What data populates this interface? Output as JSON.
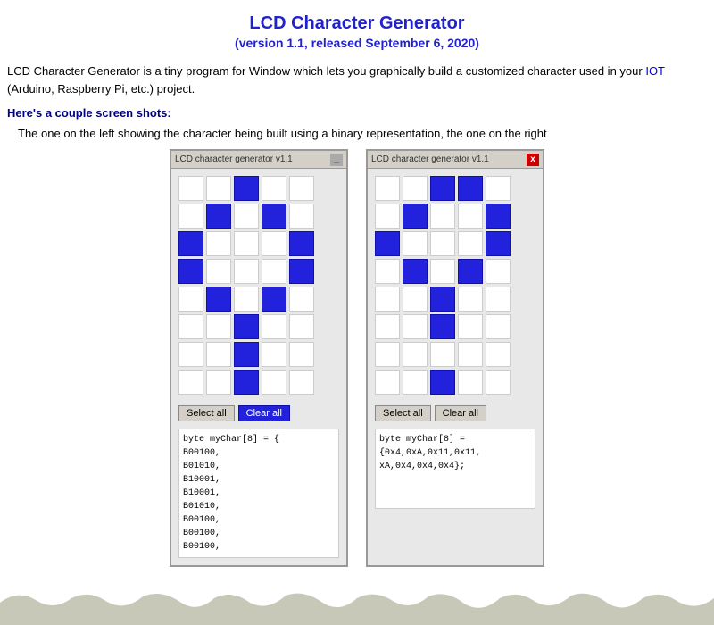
{
  "header": {
    "title": "LCD Character Generator",
    "subtitle": "(version 1.1, released September 6, 2020)"
  },
  "description": {
    "text": "LCD Character Generator is a tiny program for Window which lets you graphically build a customized character used in your IOT (Arduino, Raspberry Pi, etc.) project."
  },
  "section": {
    "title": "Here's a couple screen shots:"
  },
  "screenshot_desc": {
    "text": "The one on the left showing the character being built using a binary representation, the one on the right"
  },
  "window1": {
    "title": "LCD character generator v1.1",
    "select_all": "Select all",
    "clear_all": "Clear all",
    "grid": [
      [
        0,
        0,
        1,
        0,
        0
      ],
      [
        0,
        1,
        0,
        1,
        0
      ],
      [
        1,
        0,
        0,
        0,
        1
      ],
      [
        1,
        0,
        0,
        0,
        1
      ],
      [
        0,
        1,
        0,
        1,
        0
      ],
      [
        0,
        0,
        1,
        0,
        0
      ],
      [
        0,
        0,
        1,
        0,
        0
      ],
      [
        0,
        0,
        1,
        0,
        0
      ]
    ],
    "code": "byte myChar[8] = {\nB00100,\nB01010,\nB10001,\nB10001,\nB01010,\nB00100,\nB00100,\nB00100,"
  },
  "window2": {
    "title": "LCD character generator v1.1",
    "select_all": "Select all",
    "clear_all": "Clear all",
    "grid": [
      [
        0,
        0,
        1,
        1,
        0
      ],
      [
        0,
        1,
        0,
        0,
        1
      ],
      [
        1,
        0,
        0,
        0,
        1
      ],
      [
        0,
        1,
        0,
        1,
        0
      ],
      [
        0,
        0,
        1,
        0,
        0
      ],
      [
        0,
        0,
        1,
        0,
        0
      ],
      [
        0,
        0,
        0,
        0,
        0
      ],
      [
        0,
        0,
        1,
        0,
        0
      ]
    ],
    "code": "byte myChar[8] =\n{0x4,0xA,0x11,0x11,\nxA,0x4,0x4,0x4};"
  },
  "buttons": {
    "select_all": "Select all",
    "clear_all": "Clear all"
  }
}
